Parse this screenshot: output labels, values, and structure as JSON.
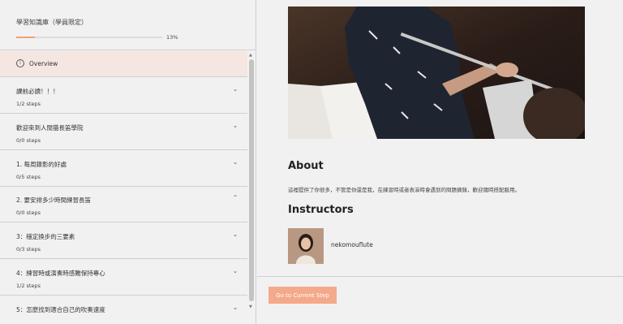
{
  "sidebar": {
    "course_title": "學習知識庫（學員限定）",
    "progress_percent": 13,
    "progress_label": "13%",
    "overview_label": "Overview",
    "lessons": [
      {
        "title": "課前必讀！！！",
        "steps": "1/2 steps",
        "expanded": false
      },
      {
        "title": "歡迎來到人閒猫長笛學院",
        "steps": "0/0 steps",
        "expanded": false
      },
      {
        "title": "1. 每周錄影的好處",
        "steps": "0/5 steps",
        "expanded": false
      },
      {
        "title": "2. 要安排多少時間練習長笛",
        "steps": "0/0 steps",
        "expanded": true
      },
      {
        "title": "3：穩定換步的三要素",
        "steps": "0/3 steps",
        "expanded": false
      },
      {
        "title": "4：練習時或演奏時感難保持專心",
        "steps": "1/2 steps",
        "expanded": false
      },
      {
        "title": "5：怎麼找到適合自己的吹奏速度",
        "steps": "",
        "expanded": false
      }
    ]
  },
  "main": {
    "about_heading": "About",
    "about_text": "這裡提供了你很多，不管是你還是我，在練習時或者表演時會遇到的問題摘錄，歡迎隨時搭配服用。",
    "instructors_heading": "Instructors",
    "instructor_name": "nekomouflute",
    "cta_label": "Go to Current Step"
  },
  "colors": {
    "accent": "#f4a98b",
    "overview_bg": "#f5e6e2",
    "progress": "#f0a070"
  },
  "icons": {
    "overview": "info-circle-icon",
    "chevron_down": "chevron-down-icon",
    "chevron_up": "chevron-up-icon"
  }
}
